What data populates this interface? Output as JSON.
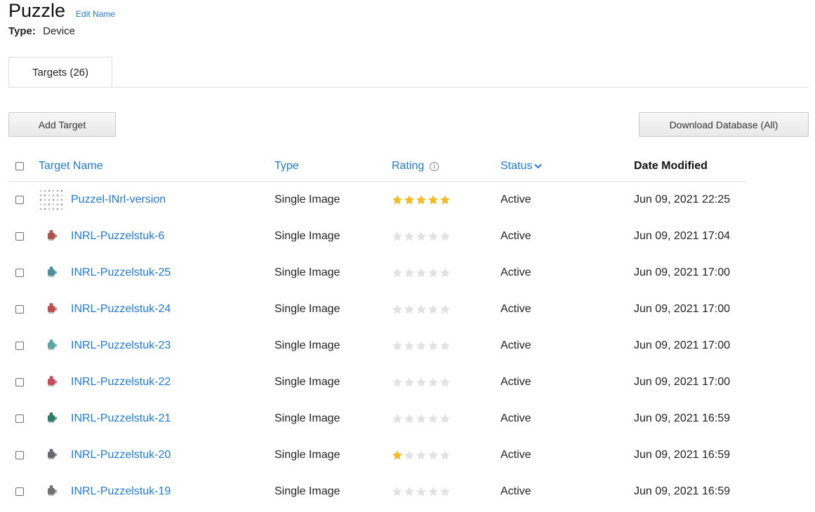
{
  "header": {
    "title": "Puzzle",
    "edit_label": "Edit Name",
    "type_label": "Type:",
    "type_value": "Device"
  },
  "tabs": [
    {
      "label": "Targets (26)"
    }
  ],
  "toolbar": {
    "add_label": "Add Target",
    "download_label": "Download Database (All)"
  },
  "table": {
    "columns": {
      "name": "Target Name",
      "type": "Type",
      "rating": "Rating",
      "status": "Status",
      "date": "Date Modified"
    },
    "rows": [
      {
        "name": "Puzzel-INrl-version",
        "type": "Single Image",
        "rating": 5,
        "status": "Active",
        "date": "Jun 09, 2021 22:25",
        "thumb": "grid",
        "thumb_color": "#8a8a8a"
      },
      {
        "name": "INRL-Puzzelstuk-6",
        "type": "Single Image",
        "rating": 0,
        "status": "Active",
        "date": "Jun 09, 2021 17:04",
        "thumb": "piece",
        "thumb_color": "#b0524a"
      },
      {
        "name": "INRL-Puzzelstuk-25",
        "type": "Single Image",
        "rating": 0,
        "status": "Active",
        "date": "Jun 09, 2021 17:00",
        "thumb": "piece",
        "thumb_color": "#4a8fa0"
      },
      {
        "name": "INRL-Puzzelstuk-24",
        "type": "Single Image",
        "rating": 0,
        "status": "Active",
        "date": "Jun 09, 2021 17:00",
        "thumb": "piece",
        "thumb_color": "#c0504d"
      },
      {
        "name": "INRL-Puzzelstuk-23",
        "type": "Single Image",
        "rating": 0,
        "status": "Active",
        "date": "Jun 09, 2021 17:00",
        "thumb": "piece",
        "thumb_color": "#5aa6a0"
      },
      {
        "name": "INRL-Puzzelstuk-22",
        "type": "Single Image",
        "rating": 0,
        "status": "Active",
        "date": "Jun 09, 2021 17:00",
        "thumb": "piece",
        "thumb_color": "#c84a5a"
      },
      {
        "name": "INRL-Puzzelstuk-21",
        "type": "Single Image",
        "rating": 0,
        "status": "Active",
        "date": "Jun 09, 2021 16:59",
        "thumb": "piece",
        "thumb_color": "#2e7d6b"
      },
      {
        "name": "INRL-Puzzelstuk-20",
        "type": "Single Image",
        "rating": 1,
        "status": "Active",
        "date": "Jun 09, 2021 16:59",
        "thumb": "piece",
        "thumb_color": "#666a70"
      },
      {
        "name": "INRL-Puzzelstuk-19",
        "type": "Single Image",
        "rating": 0,
        "status": "Active",
        "date": "Jun 09, 2021 16:59",
        "thumb": "piece",
        "thumb_color": "#707070"
      }
    ]
  },
  "colors": {
    "link": "#1f7ad6",
    "star_on": "#f5b921",
    "star_off": "#e2e2e2"
  },
  "icons": {
    "rating_info": "info-icon",
    "status_sort": "chevron-down-icon"
  }
}
